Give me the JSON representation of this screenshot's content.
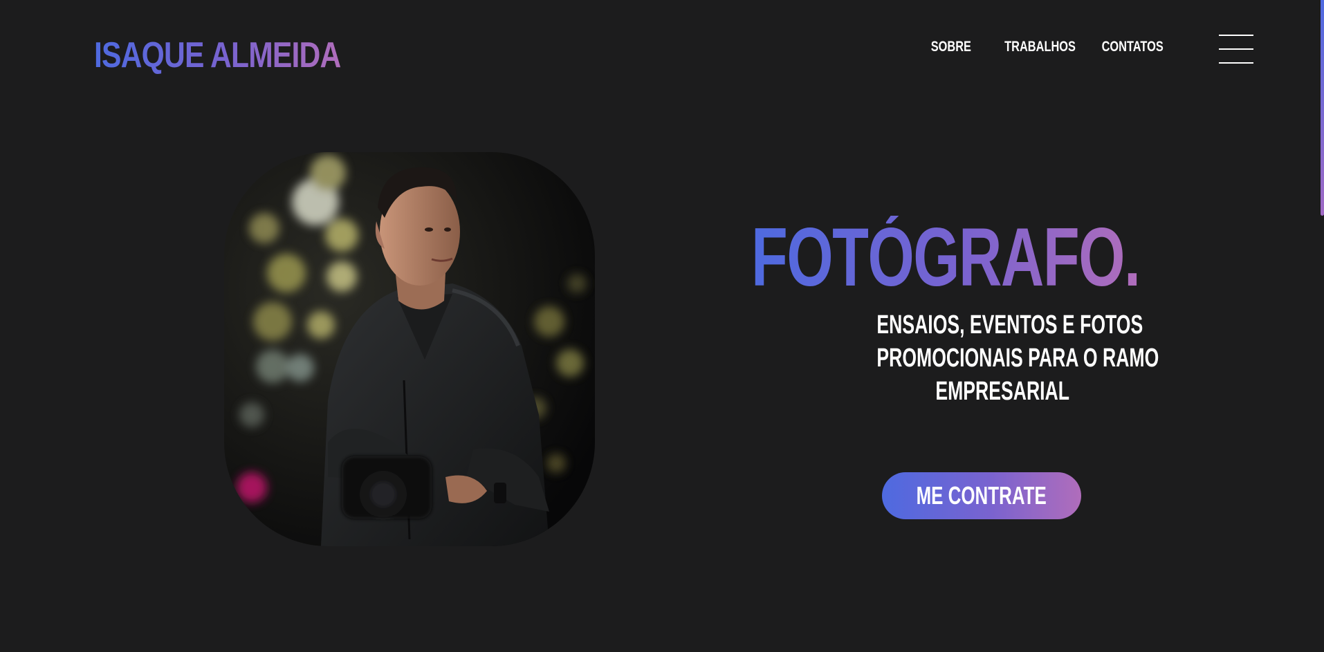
{
  "header": {
    "logo": "ISAQUE ALMEIDA",
    "nav": [
      {
        "label": "SOBRE"
      },
      {
        "label": "TRABALHOS"
      },
      {
        "label": "CONTATOS"
      }
    ],
    "menu_icon": "hamburger-menu-icon"
  },
  "hero": {
    "title": "FOTÓGRAFO.",
    "subtitle_lines": [
      "ENSAIOS, EVENTOS E FOTOS",
      "PROMOCIONAIS PARA O RAMO",
      "EMPRESARIAL"
    ],
    "cta_label": "ME CONTRATE",
    "photo": "photographer-portrait"
  },
  "colors": {
    "background": "#1c1c1d",
    "gradient_start": "#4e6ae0",
    "gradient_mid": "#7a63cf",
    "gradient_end": "#b06dbb",
    "text": "#ffffff"
  }
}
